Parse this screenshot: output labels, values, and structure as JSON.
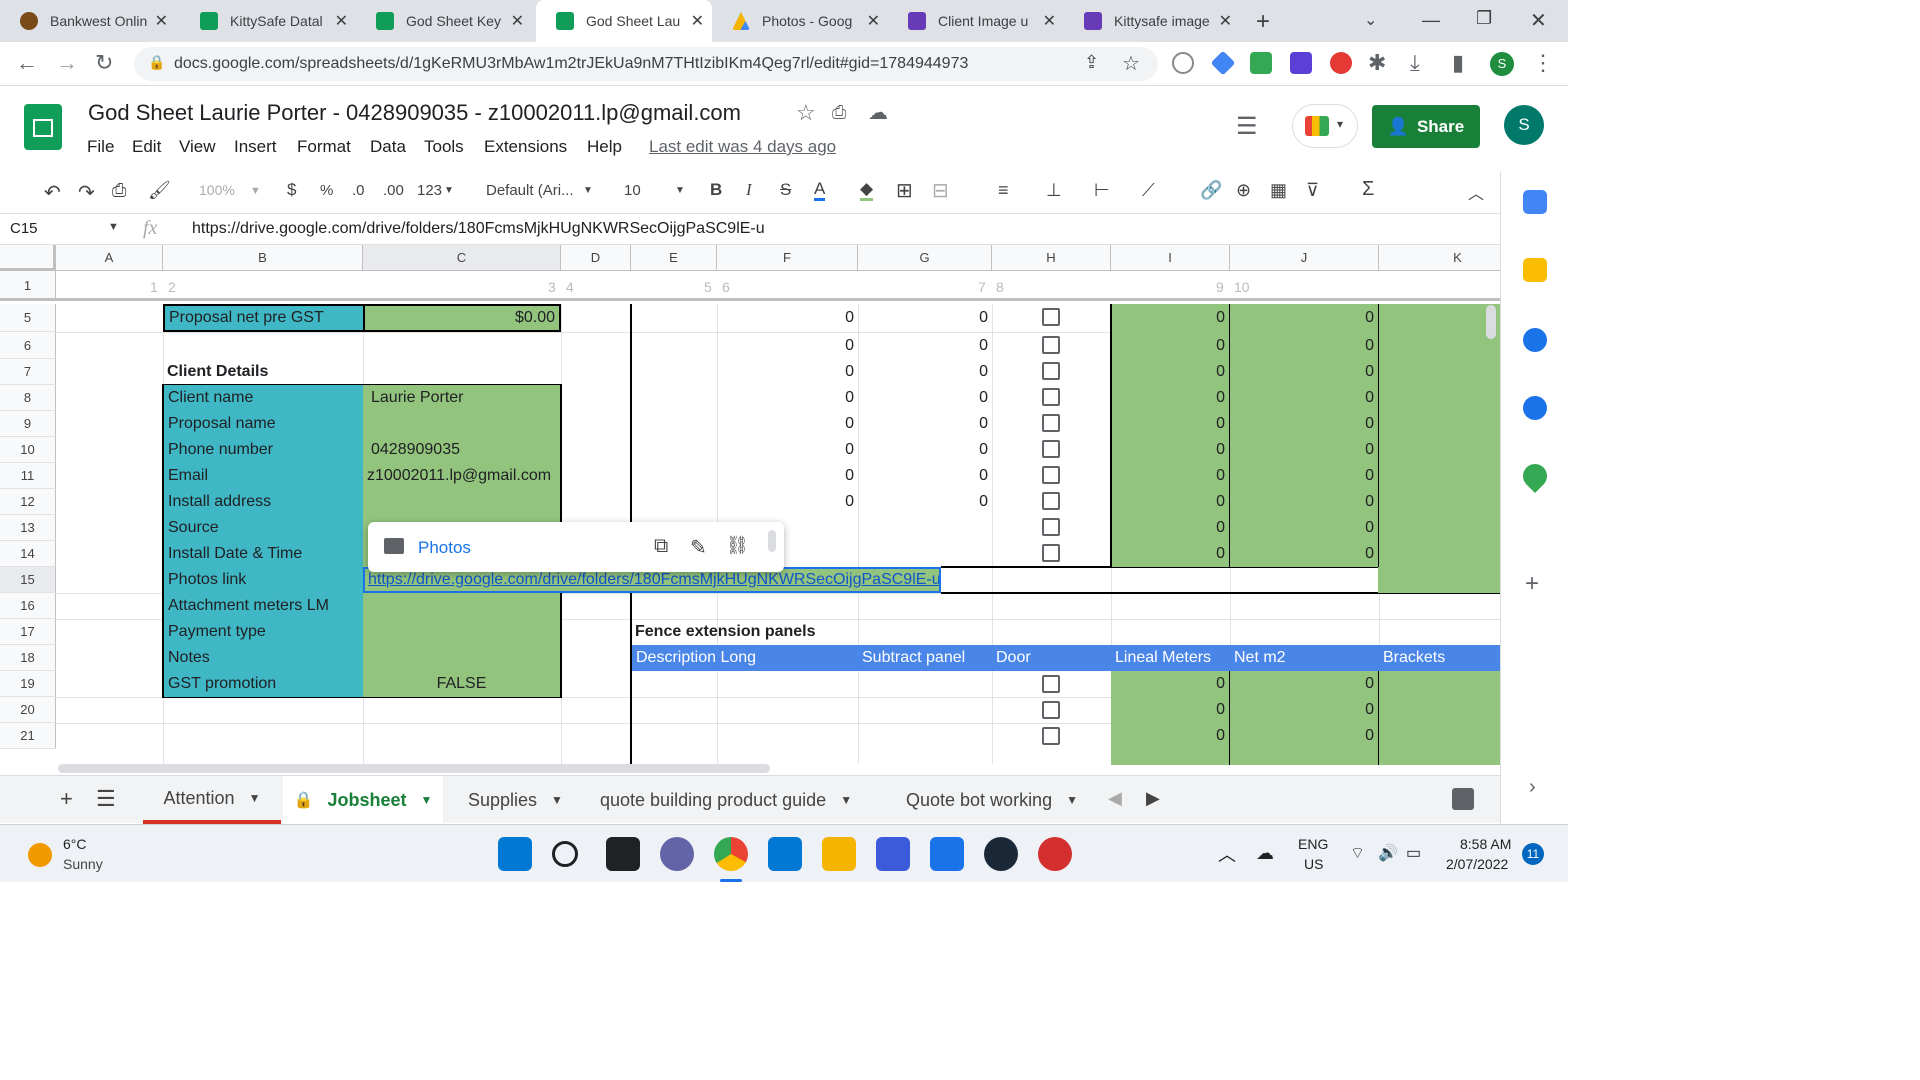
{
  "browser": {
    "tabs": [
      {
        "label": "Bankwest Onlin",
        "color": "#f4b400"
      },
      {
        "label": "KittySafe Datal",
        "color": "#0f9d58"
      },
      {
        "label": "God Sheet Key",
        "color": "#0f9d58"
      },
      {
        "label": "God Sheet Lau",
        "color": "#0f9d58"
      },
      {
        "label": "Photos - Goog",
        "color": "#4285f4"
      },
      {
        "label": "Client Image u",
        "color": "#673ab7"
      },
      {
        "label": "Kittysafe image",
        "color": "#673ab7"
      }
    ],
    "active_tab": 3,
    "new_tab": "+",
    "url": "docs.google.com/spreadsheets/d/1gKeRMU3rMbAw1m2trJEkUa9nM7THtIzibIKm4Qeg7rl/edit#gid=1784944973"
  },
  "doc": {
    "title": "God Sheet   Laurie Porter -    0428909035 - z10002011.lp@gmail.com",
    "menus": [
      "File",
      "Edit",
      "View",
      "Insert",
      "Format",
      "Data",
      "Tools",
      "Extensions",
      "Help"
    ],
    "last_edit": "Last edit was 4 days ago",
    "share": "Share",
    "avatar": "S"
  },
  "toolbar": {
    "zoom": "100%",
    "currency": "$",
    "percent": "%",
    "dec_less": ".0",
    "dec_more": ".00",
    "more_formats": "123",
    "font": "Default (Ari...",
    "size": "10",
    "bold": "B",
    "italic": "I",
    "strike": "S",
    "textcolor": "A"
  },
  "formula": {
    "cell": "C15",
    "fx": "fx",
    "value": "https://drive.google.com/drive/folders/180FcmsMjkHUgNKWRSecOijgPaSC9lE-u"
  },
  "grid": {
    "columns": [
      "A",
      "B",
      "C",
      "D",
      "E",
      "F",
      "G",
      "H",
      "I",
      "J",
      "K"
    ],
    "group_row": [
      "1",
      "2",
      "3",
      "4",
      "5",
      "6",
      "7",
      "8",
      "9",
      "10"
    ],
    "rows": [
      "1",
      "5",
      "6",
      "7",
      "8",
      "9",
      "10",
      "11",
      "12",
      "13",
      "14",
      "15",
      "16",
      "17",
      "18",
      "19",
      "20",
      "21"
    ],
    "proposal_label": "Proposal net pre GST",
    "proposal_value": "$0.00",
    "client_details": "Client Details",
    "labels": [
      "Client name",
      "Proposal name",
      "Phone number",
      "Email",
      "Install address",
      "Source",
      "Install Date & Time",
      "Photos link",
      "Attachment meters LM",
      "Payment type",
      "Notes",
      "GST promotion"
    ],
    "values": [
      "Laurie Porter",
      "",
      "0428909035",
      "z10002011.lp@gmail.com",
      "",
      "",
      "",
      "https://drive.google.com/drive/folders/180FcmsMjkHUgNKWRSecOijgPaSC9lE-u",
      "",
      "",
      "",
      "FALSE"
    ],
    "zero": "0",
    "fence_title": "Fence extension panels",
    "fence_headers": [
      "Description Long",
      "Subtract panel",
      "Door",
      "Lineal Meters",
      "Net m2",
      "Brackets"
    ]
  },
  "popup": {
    "label": "Photos"
  },
  "sheets": {
    "add": "+",
    "tabs": [
      "Attention",
      "Jobsheet",
      "Supplies",
      "quote building product guide",
      "Quote bot working"
    ],
    "active": 1
  },
  "taskbar": {
    "temp": "6°C",
    "weather": "Sunny",
    "lang1": "ENG",
    "lang2": "US",
    "time": "8:58 AM",
    "date": "2/07/2022",
    "notif": "11"
  }
}
